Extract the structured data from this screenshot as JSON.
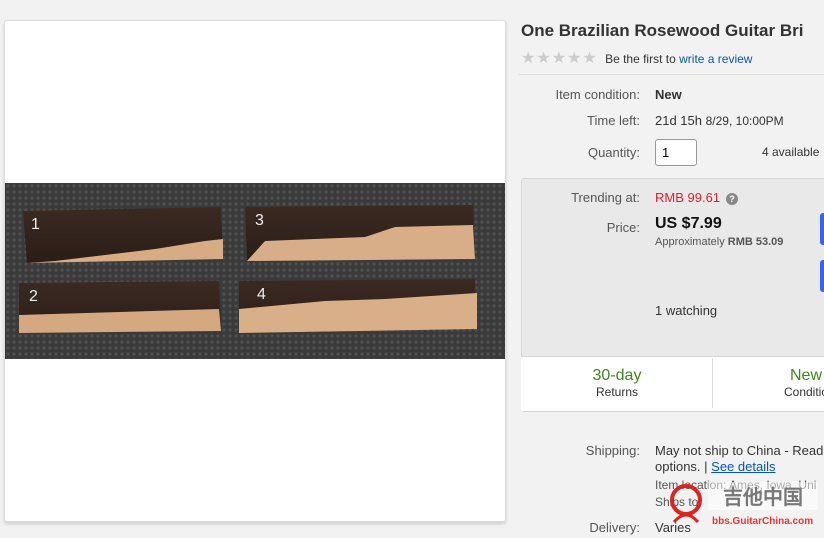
{
  "listing": {
    "title": "One Brazilian Rosewood Guitar Bri",
    "rating": {
      "stars": 0,
      "max": 5,
      "prompt": "Be the first to",
      "link": "write a review"
    },
    "condition": {
      "label": "Item condition:",
      "value": "New"
    },
    "time_left": {
      "label": "Time left:",
      "value": "21d 15h",
      "detail": "8/29, 10:00PM"
    },
    "quantity": {
      "label": "Quantity:",
      "value": "1",
      "available": "4 available"
    }
  },
  "buy_box": {
    "trending": {
      "label": "Trending at:",
      "value": "RMB 99.61",
      "help": "?"
    },
    "price": {
      "label": "Price:",
      "value": "US $7.99",
      "approx_prefix": "Approximately",
      "approx_value": "RMB 53.09"
    },
    "watching": "1 watching",
    "returns": [
      {
        "big": "30-day",
        "small": "Returns"
      },
      {
        "big": "New",
        "small": "Conditio"
      }
    ]
  },
  "shipping": {
    "label": "Shipping:",
    "line1": "May not ship to China - Read",
    "line2_prefix": "options. |",
    "line2_link": "See details",
    "location": "Item location: Ames, Iowa, Uni",
    "ships_to": "Ships to:"
  },
  "delivery": {
    "label": "Delivery:",
    "value": "Varies"
  },
  "watermark": {
    "site": "bbs.GuitarChina.com"
  },
  "colors": {
    "accent_blue": "#3665f3",
    "link_blue": "#0654ba",
    "green": "#3a8a1e",
    "trending_red": "#dd1e31"
  },
  "photo": {
    "piece_labels": [
      "1",
      "2",
      "3",
      "4"
    ]
  }
}
